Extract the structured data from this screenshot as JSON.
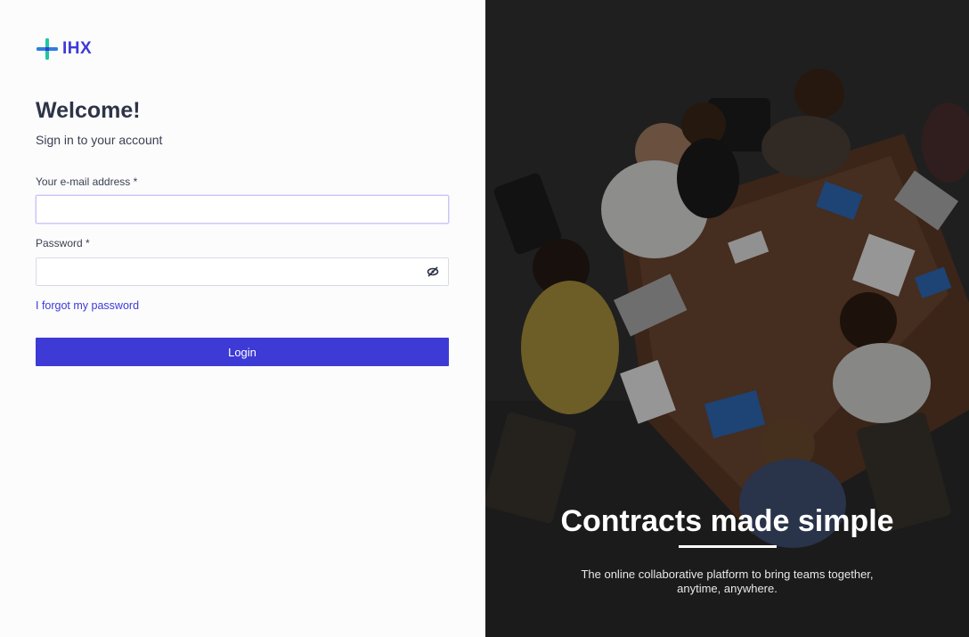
{
  "brand": {
    "name": "IHX",
    "logo_icon": "cross-plus-icon"
  },
  "login": {
    "heading": "Welcome!",
    "subheading": "Sign in to your account",
    "email_label": "Your e-mail address *",
    "email_value": "",
    "password_label": "Password *",
    "password_value": "",
    "toggle_icon": "eye-slash-icon",
    "forgot_link": "I forgot my password",
    "login_button": "Login"
  },
  "hero": {
    "title": "Contracts made simple",
    "description": "The online collaborative platform to bring teams together, anytime, anywhere."
  },
  "colors": {
    "accent": "#3d3ad6",
    "logo_green": "#1fc6a0",
    "logo_blue": "#2f7de1"
  }
}
